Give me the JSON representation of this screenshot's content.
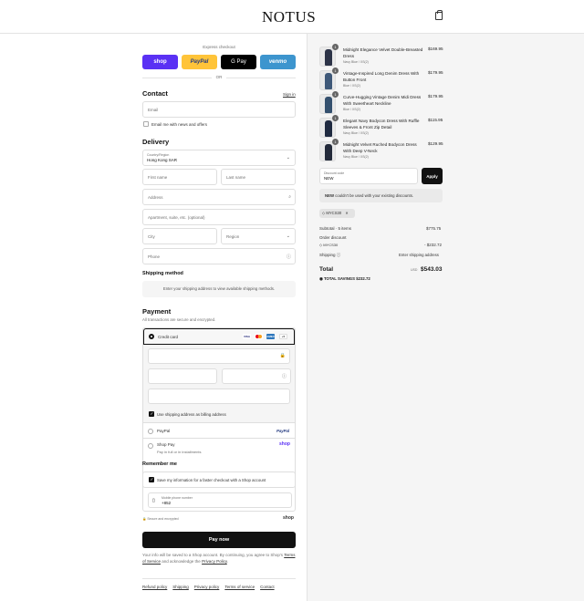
{
  "header": {
    "logo": "NOTUS"
  },
  "express": {
    "label": "Express checkout",
    "shop": "shop",
    "paypal": "PayPal",
    "gpay": "G Pay",
    "venmo": "venmo",
    "or": "OR"
  },
  "contact": {
    "title": "Contact",
    "signin": "Sign in",
    "email_placeholder": "Email",
    "news_label": "Email me with news and offers"
  },
  "delivery": {
    "title": "Delivery",
    "country_label": "Country/Region",
    "country_value": "Hong Kong SAR",
    "first_name": "First name",
    "last_name": "Last name",
    "address": "Address",
    "apartment": "Apartment, suite, etc. (optional)",
    "city": "City",
    "region": "Region",
    "phone": "Phone"
  },
  "shipping": {
    "title": "Shipping method",
    "notice": "Enter your shipping address to view available shipping methods."
  },
  "payment": {
    "title": "Payment",
    "subtitle": "All transactions are secure and encrypted.",
    "credit_card": "Credit card",
    "cards": [
      "VISA",
      "MC",
      "AMEX",
      "+5"
    ],
    "billing_label": "Use shipping address as billing address",
    "paypal_label": "PayPal",
    "paypal_logo": "PayPal",
    "shoppay_label": "Shop Pay",
    "shoppay_sub": "Pay in full or in installments",
    "shoppay_logo": "shop"
  },
  "remember": {
    "title": "Remember me",
    "save_label": "Save my information for a faster checkout with a Shop account",
    "mobile_label": "Mobile phone number",
    "mobile_value": "+852",
    "secure_text": "Secure and encrypted",
    "shop_logo": "shop"
  },
  "paynow": "Pay now",
  "legal": {
    "line1": "Your info will be saved to a Shop account. By continuing, you agree to Shop's",
    "terms": "Terms of Service",
    "mid": " and acknowledge the ",
    "privacy": "Privacy Policy",
    "end": "."
  },
  "footer": [
    "Refund policy",
    "Shipping",
    "Privacy policy",
    "Terms of service",
    "Contact"
  ],
  "cart": {
    "items": [
      {
        "qty": "1",
        "name": "Midnight Elegance Velvet Double-Breasted Dress",
        "variant": "Navy Blue / XS(2)",
        "price": "$169.95"
      },
      {
        "qty": "1",
        "name": "Vintage-Inspired Long Denim Dress With Button Front",
        "variant": "Blue / XS(2)",
        "price": "$179.95"
      },
      {
        "qty": "1",
        "name": "Curve-Hugging Vintage Denim Midi Dress With Sweetheart Neckline",
        "variant": "Blue / XS(2)",
        "price": "$179.95"
      },
      {
        "qty": "1",
        "name": "Elegant Navy Bodycon Dress With Ruffle Sleeves & Front Zip Detail",
        "variant": "Navy Blue / XS(2)",
        "price": "$115.95"
      },
      {
        "qty": "1",
        "name": "Midnight Velvet Ruched Bodycon Dress With Deep V-Neck",
        "variant": "Navy Blue / XS(2)",
        "price": "$129.95"
      }
    ],
    "discount_label": "Discount code",
    "discount_value": "NEW",
    "apply": "Apply",
    "error_code": "NEW",
    "error_text": " couldn't be used with your existing discounts.",
    "applied_code": "MYCS30",
    "subtotal_label": "Subtotal · 5 items",
    "subtotal_value": "$775.75",
    "order_discount_label": "Order discount",
    "discount_code_name": "MYCS30",
    "discount_amount": "- $232.72",
    "shipping_label": "Shipping",
    "shipping_value": "Enter shipping address",
    "total_label": "Total",
    "currency": "USD",
    "total_value": "$543.03",
    "savings_label": "TOTAL SAVINGS",
    "savings_value": "$232.72"
  },
  "colors": {
    "shop": "#5a31f4",
    "paypal": "#ffc439",
    "gpay": "#000000",
    "venmo": "#3d95ce",
    "dark": "#111111"
  }
}
